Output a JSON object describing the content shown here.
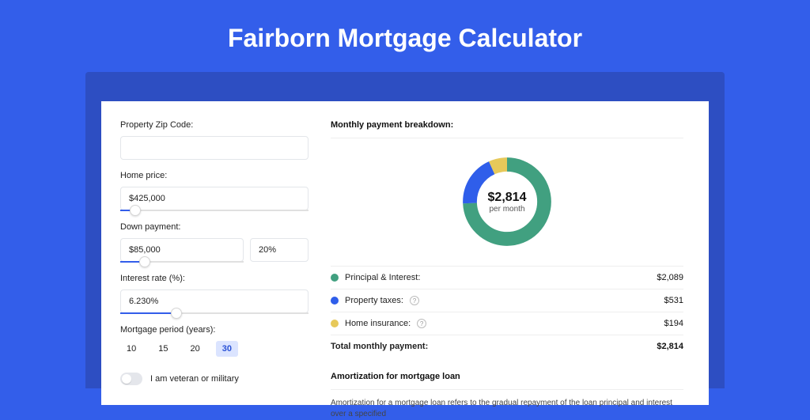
{
  "title": "Fairborn Mortgage Calculator",
  "form": {
    "zip": {
      "label": "Property Zip Code:",
      "value": ""
    },
    "home_price": {
      "label": "Home price:",
      "value": "$425,000",
      "slider_pct": 8
    },
    "down_payment": {
      "label": "Down payment:",
      "amount": "$85,000",
      "pct": "20%",
      "slider_pct": 20
    },
    "interest_rate": {
      "label": "Interest rate (%):",
      "value": "6.230%",
      "slider_pct": 30
    },
    "period": {
      "label": "Mortgage period (years):",
      "options": [
        "10",
        "15",
        "20",
        "30"
      ],
      "selected": "30"
    },
    "veteran": {
      "label": "I am veteran or military",
      "checked": false
    }
  },
  "breakdown": {
    "title": "Monthly payment breakdown:",
    "center_amount": "$2,814",
    "center_sub": "per month",
    "rows": [
      {
        "key": "principal_interest",
        "label": "Principal & Interest:",
        "value": "$2,089",
        "color": "#41a080",
        "dot": "dot-green",
        "info": false
      },
      {
        "key": "property_taxes",
        "label": "Property taxes:",
        "value": "$531",
        "color": "#2f5eea",
        "dot": "dot-blue",
        "info": true
      },
      {
        "key": "home_insurance",
        "label": "Home insurance:",
        "value": "$194",
        "color": "#e7c95a",
        "dot": "dot-yellow",
        "info": true
      }
    ],
    "total": {
      "label": "Total monthly payment:",
      "value": "$2,814"
    }
  },
  "chart_data": {
    "type": "pie",
    "title": "Monthly payment breakdown",
    "series": [
      {
        "name": "Principal & Interest",
        "value": 2089,
        "color": "#41a080"
      },
      {
        "name": "Property taxes",
        "value": 531,
        "color": "#2f5eea"
      },
      {
        "name": "Home insurance",
        "value": 194,
        "color": "#e7c95a"
      }
    ],
    "total": 2814,
    "center_label": "$2,814 per month"
  },
  "amortization": {
    "title": "Amortization for mortgage loan",
    "body": "Amortization for a mortgage loan refers to the gradual repayment of the loan principal and interest over a specified"
  }
}
